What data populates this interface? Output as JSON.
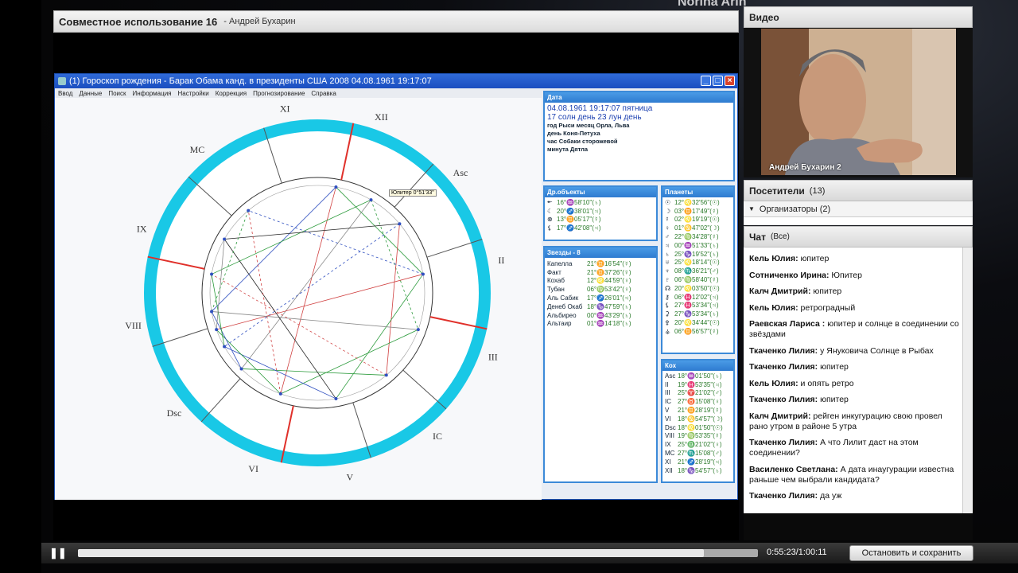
{
  "header": {
    "title": "Совместное использование 16",
    "user": "- Андрей Бухарин"
  },
  "background_text": "Norina Arin",
  "window": {
    "title": "(1) Гороскоп рождения - Барак Обама канд. в президенты США 2008 04.08.1961  19:17:07",
    "menu": [
      "Ввод",
      "Данные",
      "Поиск",
      "Информация",
      "Настройки",
      "Коррекция",
      "Прогнозирование",
      "Справка"
    ],
    "tooltip": "Юпитер 0°51'33\""
  },
  "houses": [
    "XI",
    "XII",
    "Asc",
    "II",
    "III",
    "IC",
    "V",
    "VI",
    "Dsc",
    "VIII",
    "IX",
    "MC"
  ],
  "date_panel": {
    "title": "Дата",
    "line1": "04.08.1961  19:17:07 пятница",
    "line2": "17 солн день 23 лун день",
    "lines": [
      "год Рыси        месяц Орла, Льва",
      "день Коня-Петуха",
      "час Собаки сторожевой",
      "минута Дятла"
    ]
  },
  "other_panel": {
    "title": "Др.объекты",
    "rows": [
      {
        "sym": "⯬",
        "val": "16°♒58'10\"(♄)"
      },
      {
        "sym": "☾",
        "val": "20°♐38'01\"(♃)"
      },
      {
        "sym": "⊗",
        "val": "13°♊05'17\"(☿)"
      },
      {
        "sym": "⚸",
        "val": "17°♐42'08\"(♃)"
      }
    ]
  },
  "stars_panel": {
    "title": "Звезды - 8",
    "rows": [
      {
        "name": "Капелла",
        "val": "21°♊16'54\"(☿)"
      },
      {
        "name": "Факт",
        "val": "21°♊37'26\"(☿)"
      },
      {
        "name": "Кохаб",
        "val": "12°♌44'59\"(♀)"
      },
      {
        "name": "Тубан",
        "val": "06°♍53'42\"(♀)"
      },
      {
        "name": "Аль Сабик",
        "val": "17°♐26'01\"(♃)"
      },
      {
        "name": "Денеб Окаб",
        "val": "18°♑47'59\"(♄)"
      },
      {
        "name": "Альбирео",
        "val": "00°♒43'29\"(♄)"
      },
      {
        "name": "Альтаир",
        "val": "01°♒14'18\"(♄)"
      }
    ]
  },
  "planets_panel": {
    "title": "Планеты",
    "rows": [
      {
        "sym": "☉",
        "val": "12°♌32'56\"(☉)"
      },
      {
        "sym": "☽",
        "val": "03°♊17'49\"(☿)"
      },
      {
        "sym": "☿",
        "val": "02°♌19'19\"(☉)"
      },
      {
        "sym": "♀",
        "val": "01°♋47'02\"(☽)"
      },
      {
        "sym": "♂",
        "val": "22°♍34'28\"(☿)"
      },
      {
        "sym": "♃",
        "val": "00°♒51'33\"(♄)"
      },
      {
        "sym": "♄",
        "val": "25°♑19'52\"(♄)"
      },
      {
        "sym": "♅",
        "val": "25°♌18'14\"(☉)"
      },
      {
        "sym": "♆",
        "val": "08°♏36'21\"(♂)"
      },
      {
        "sym": "♇",
        "val": "06°♍58'40\"(☿)"
      },
      {
        "sym": "☊",
        "val": "20°♌03'50\"(☉)"
      },
      {
        "sym": "⚷",
        "val": "06°♓12'02\"(♃)"
      },
      {
        "sym": "⚸",
        "val": "27°♓53'34\"(♃)"
      },
      {
        "sym": "⚳",
        "val": "27°♑53'34\"(♄)"
      },
      {
        "sym": "⚴",
        "val": "20°♌34'44\"(☉)"
      },
      {
        "sym": "⚶",
        "val": "06°♊56'57\"(☿)"
      }
    ]
  },
  "cusps_panel": {
    "title": "Кох",
    "rows": [
      {
        "name": "Asc",
        "val": "18°♒01'50\"(♄)"
      },
      {
        "name": "II",
        "val": "19°♓53'35\"(♃)"
      },
      {
        "name": "III",
        "val": "25°♈21'02\"(♂)"
      },
      {
        "name": "IC",
        "val": "27°♉15'08\"(♀)"
      },
      {
        "name": "V",
        "val": "21°♊28'19\"(☿)"
      },
      {
        "name": "VI",
        "val": "18°♋54'57\"(☽)"
      },
      {
        "name": "Dsc",
        "val": "18°♌01'50\"(☉)"
      },
      {
        "name": "VIII",
        "val": "19°♍53'35\"(☿)"
      },
      {
        "name": "IX",
        "val": "25°♎21'02\"(♀)"
      },
      {
        "name": "MC",
        "val": "27°♏15'08\"(♂)"
      },
      {
        "name": "XI",
        "val": "21°♐28'19\"(♃)"
      },
      {
        "name": "XII",
        "val": "18°♑54'57\"(♄)"
      }
    ]
  },
  "video": {
    "title": "Видео",
    "caption": "Андрей Бухарин 2"
  },
  "attendees": {
    "title": "Посетители",
    "count": "(13)",
    "group": "Организаторы (2)"
  },
  "chat": {
    "title": "Чат",
    "scope": "(Все)",
    "messages": [
      {
        "who": "Кель Юлия:",
        "text": "юпитер"
      },
      {
        "who": "Сотниченко Ирина:",
        "text": "Юпитер"
      },
      {
        "who": "Калч Дмитрий:",
        "text": "юпитер"
      },
      {
        "who": "Кель Юлия:",
        "text": "ретроградный"
      },
      {
        "who": "Раевская   Лариса :",
        "text": "юпитер и солнце в соединении со звёздами"
      },
      {
        "who": "Ткаченко Лилия:",
        "text": "у Януковича Солнце в Рыбах"
      },
      {
        "who": "Ткаченко Лилия:",
        "text": "юпитер"
      },
      {
        "who": "Кель Юлия:",
        "text": "и опять ретро"
      },
      {
        "who": "Ткаченко Лилия:",
        "text": "юпитер"
      },
      {
        "who": "Калч Дмитрий:",
        "text": "рейген инкугурацию   свою провел рано утром в районе 5 утра"
      },
      {
        "who": "Ткаченко Лилия:",
        "text": "А что Лилит даст на этом соединении?"
      },
      {
        "who": "Василенко Светлана:",
        "text": "А дата инаугурации известна раньше чем выбрали кандидата?"
      },
      {
        "who": "Ткаченко Лилия:",
        "text": "да уж"
      }
    ]
  },
  "player": {
    "time": "0:55:23/1:00:11",
    "progress": 0.92,
    "stop_label": "Остановить и сохранить"
  },
  "colors": {
    "wheel": "#19c8e6",
    "titlebar": "#1a4ec0",
    "panel_border": "#3c8ad8",
    "panel_header": "#2f7bd0",
    "red": "#e0302a",
    "green": "#2a9a3a"
  }
}
